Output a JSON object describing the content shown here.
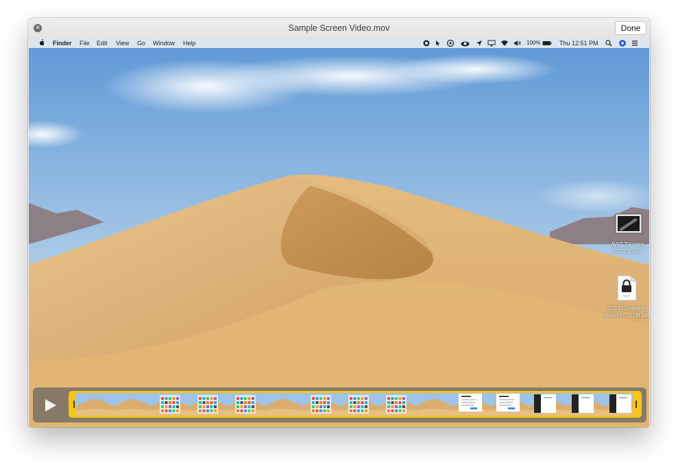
{
  "window": {
    "title": "Sample Screen Video.mov",
    "done_label": "Done"
  },
  "menubar": {
    "apple_menu": "apple-icon",
    "items": [
      "Finder",
      "File",
      "Edit",
      "View",
      "Go",
      "Window",
      "Help"
    ],
    "battery": "100%",
    "clock": "Thu 12:51 PM"
  },
  "desktop": {
    "icons": [
      {
        "label1": "AWT TV Intro",
        "label2": "TITLES.mp4",
        "icon": "video-file-icon"
      },
      {
        "label1": "2017 Complete",
        "label2": "return fo...018).pdf",
        "icon": "locked-pdf-icon"
      }
    ]
  },
  "player": {
    "play_icon": "play-icon",
    "frames": [
      "desert",
      "desert",
      "icons",
      "icons",
      "icons",
      "desert",
      "icons",
      "icons",
      "icons",
      "desert",
      "welcome",
      "welcome",
      "dark",
      "dark",
      "dark"
    ]
  },
  "colors": {
    "trim_accent": "#f5c518",
    "sky": "#7fb0dc",
    "sand": "#d9a966"
  }
}
